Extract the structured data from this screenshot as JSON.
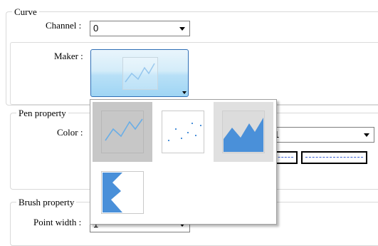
{
  "curve": {
    "legend": "Curve",
    "channel_label": "Channel :",
    "channel_value": "0",
    "maker_label": "Maker :"
  },
  "pen": {
    "legend": "Pen property",
    "color_label": "Color :",
    "combo_value": "1"
  },
  "brush": {
    "legend": "Brush property",
    "point_width_label": "Point width :",
    "point_width_value": "1"
  },
  "maker_options": [
    {
      "icon": "line-chart-icon",
      "state": "selected"
    },
    {
      "icon": "scatter-chart-icon",
      "state": "normal"
    },
    {
      "icon": "area-chart-icon",
      "state": "hover"
    },
    {
      "icon": "bar-area-chart-icon",
      "state": "normal"
    }
  ],
  "colors": {
    "accent_blue": "#4a90d9",
    "button_border": "#2f6fb6",
    "dash_blue": "#3b5fd0"
  }
}
